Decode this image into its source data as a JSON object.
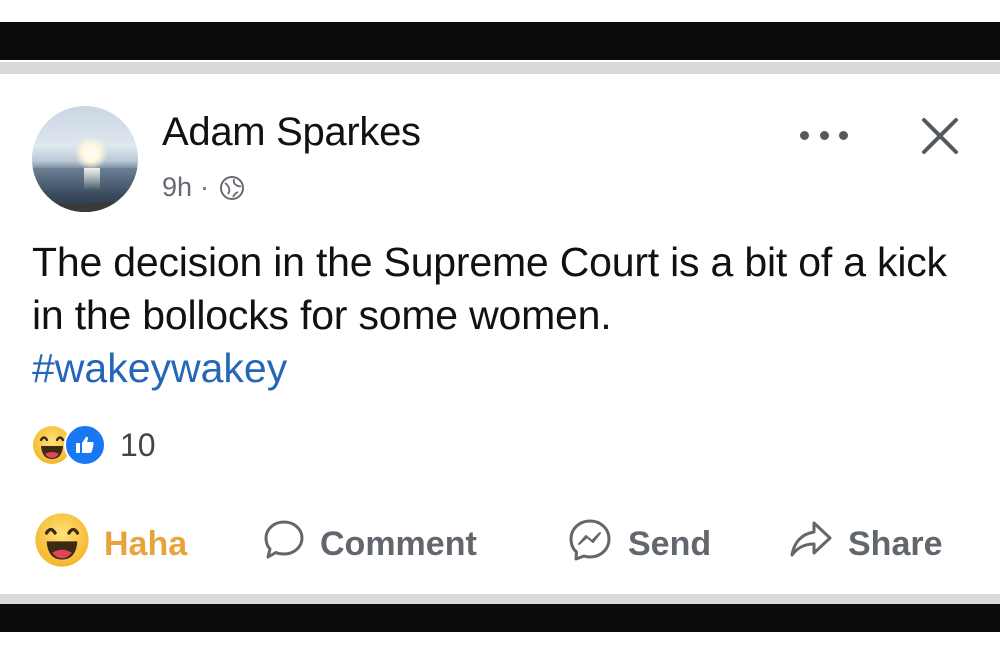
{
  "post": {
    "author": "Adam Sparkes",
    "time": "9h",
    "separator": "·",
    "audience_icon": "globe-icon",
    "text": "The decision in the Supreme Court is a bit of a kick in the bollocks for some women.",
    "hashtag": "#wakeywakey"
  },
  "reactions": {
    "icons": [
      "haha-emoji-icon",
      "like-thumb-icon"
    ],
    "count": "10"
  },
  "actions": {
    "haha": "Haha",
    "comment": "Comment",
    "send": "Send",
    "share": "Share"
  },
  "colors": {
    "hashtag": "#2466b8",
    "haha_active": "#e8a33d",
    "like_blue": "#1877f2",
    "muted": "#62676d"
  }
}
